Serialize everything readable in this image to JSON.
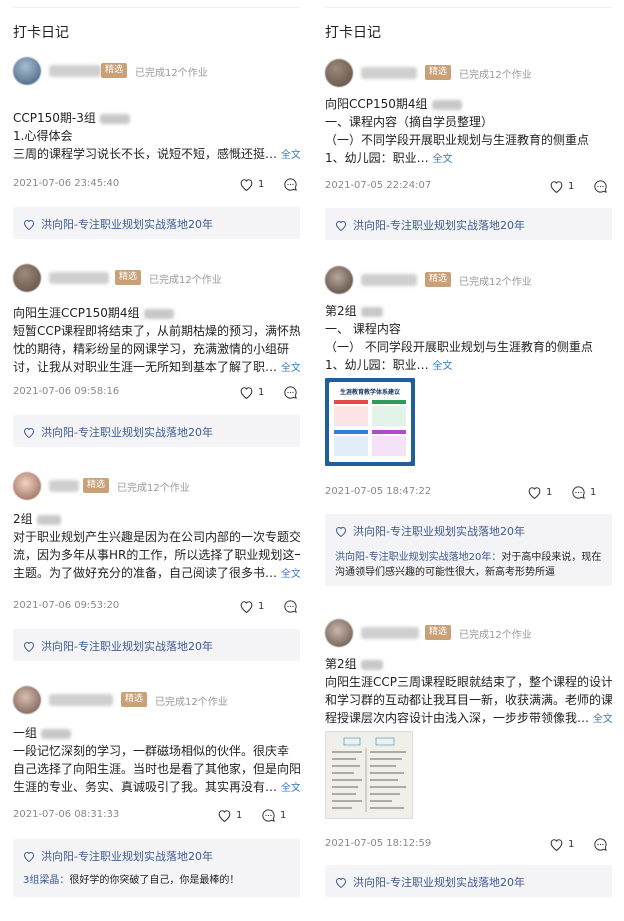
{
  "left": {
    "title": "打卡日记",
    "posts": [
      {
        "badge": "精选",
        "done": "已完成12个作业",
        "lines": [
          "CCP150期-3组",
          "1.心得体会",
          "三周的课程学习说长不长，说短不短，感慨还挺…"
        ],
        "more": "全文",
        "date": "2021-07-06 23:45:40",
        "likes": "1",
        "comments": "",
        "footer": "洪向阳-专注职业规划实战落地20年"
      },
      {
        "badge": "精选",
        "done": "已完成12个作业",
        "lines": [
          "向阳生涯CCP150期4组",
          "短暂CCP课程即将结束了，从前期枯燥的预习，满怀热",
          "忱的期待，精彩纷呈的网课学习，充满激情的小组研",
          "讨，让我从对职业生涯一无所知到基本了解了职…"
        ],
        "more": "全文",
        "date": "2021-07-06 09:58:16",
        "likes": "1",
        "comments": "",
        "footer": "洪向阳-专注职业规划实战落地20年"
      },
      {
        "badge": "精选",
        "done": "已完成12个作业",
        "lines": [
          "2组",
          "对于职业规划产生兴趣是因为在公司内部的一次专题交",
          "流，因为多年从事HR的工作，所以选择了职业规划这一",
          "主题。为了做好充分的准备，自己阅读了很多书…"
        ],
        "more": "全文",
        "date": "2021-07-06 09:53:20",
        "likes": "1",
        "comments": "",
        "footer": "洪向阳-专注职业规划实战落地20年"
      },
      {
        "badge": "精选",
        "done": "已完成12个作业",
        "lines": [
          "一组",
          "  一段记忆深刻的学习，一群磁场相似的伙伴。很庆幸",
          "自己选择了向阳生涯。当时也是看了其他家，但是向阳",
          "生涯的专业、务实、真诚吸引了我。其实再没有…"
        ],
        "more": "全文",
        "date": "2021-07-06 08:31:33",
        "likes": "1",
        "comments": "1",
        "footer": "洪向阳-专注职业规划实战落地20年",
        "comment_who": "3组梁晶：",
        "comment_text": "很好学的你突破了自己，你是最棒的！"
      }
    ]
  },
  "right": {
    "title": "打卡日记",
    "posts": [
      {
        "badge": "精选",
        "done": "已完成12个作业",
        "lines": [
          "向阳CCP150期4组",
          "一、课程内容（摘自学员整理）",
          "（一）不同学段开展职业规划与生涯教育的侧重点",
          "1、幼儿园：职业…"
        ],
        "more": "全文",
        "date": "2021-07-05 22:24:07",
        "likes": "1",
        "comments": "",
        "footer": "洪向阳-专注职业规划实战落地20年"
      },
      {
        "badge": "精选",
        "done": "已完成12个作业",
        "lines": [
          "第2组",
          "一、    课程内容",
          "（一）  不同学段开展职业规划与生涯教育的侧重点",
          "1、幼儿园：职业…"
        ],
        "more": "全文",
        "image_title": "生涯教育教学体系建议",
        "date": "2021-07-05 18:47:22",
        "likes": "1",
        "comments": "1",
        "footer": "洪向阳-专注职业规划实战落地20年",
        "comment_who": "洪向阳-专注职业规划实战落地20年：",
        "comment_text": "对于高中段来说，现在沟通领导们感兴趣的可能性很大，新高考形势所逼"
      },
      {
        "badge": "精选",
        "done": "已完成12个作业",
        "lines": [
          "第2组",
          "向阳生涯CCP三周课程眨眼就结束了，整个课程的设计",
          "和学习群的互动都让我耳目一新，收获满满。老师的课",
          "程授课层次内容设计由浅入深，一步步带领像我…"
        ],
        "more": "全文",
        "date": "2021-07-05 18:12:59",
        "likes": "1",
        "comments": "",
        "footer": "洪向阳-专注职业规划实战落地20年"
      }
    ]
  },
  "icons": {
    "heart": "heart-icon",
    "comment": "comment-icon"
  },
  "colors": {
    "accent": "#3a7ab8",
    "badge": "#c9a077",
    "footer_text": "#3c5b8f",
    "box_bg": "#f4f4f6"
  }
}
